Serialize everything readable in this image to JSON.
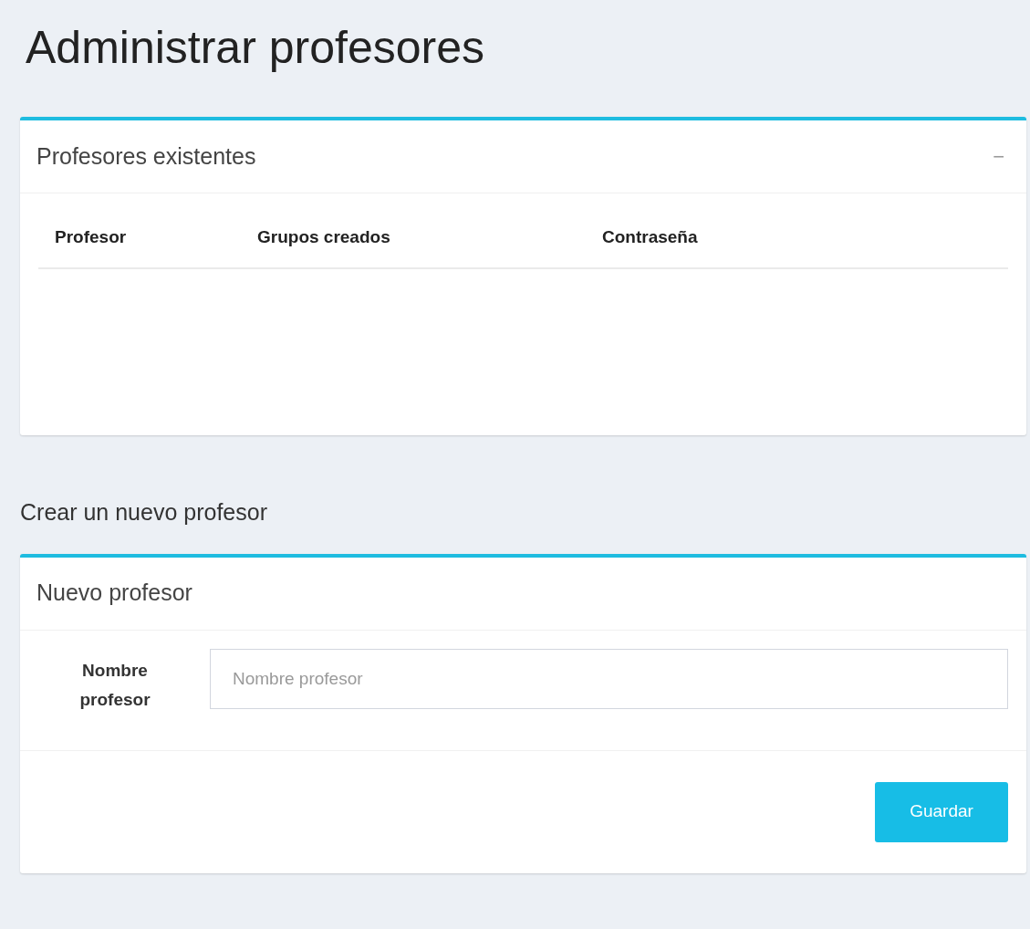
{
  "page_title": "Administrar profesores",
  "existing_box": {
    "title": "Profesores existentes",
    "collapse_symbol": "−",
    "table": {
      "columns": [
        "Profesor",
        "Grupos creados",
        "Contraseña"
      ]
    }
  },
  "section_title": "Crear un nuevo profesor",
  "new_box": {
    "title": "Nuevo profesor",
    "field": {
      "label": "Nombre profesor",
      "placeholder": "Nombre profesor"
    },
    "button": "Guardar"
  }
}
